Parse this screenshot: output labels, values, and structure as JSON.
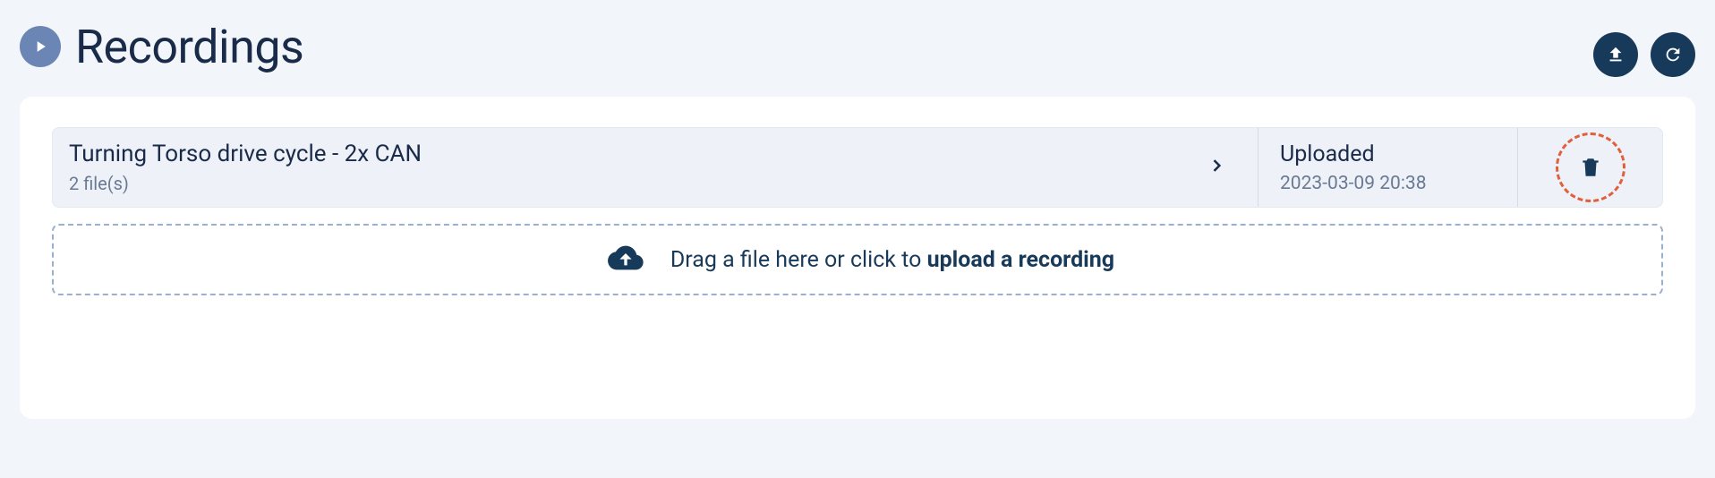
{
  "page_title": "Recordings",
  "recordings": [
    {
      "title": "Turning Torso drive cycle - 2x CAN",
      "file_count_text": "2 file(s)",
      "status_label": "Uploaded",
      "status_time": "2023-03-09 20:38"
    }
  ],
  "dropzone": {
    "prefix": "Drag a file here or click to ",
    "action": "upload a recording"
  }
}
